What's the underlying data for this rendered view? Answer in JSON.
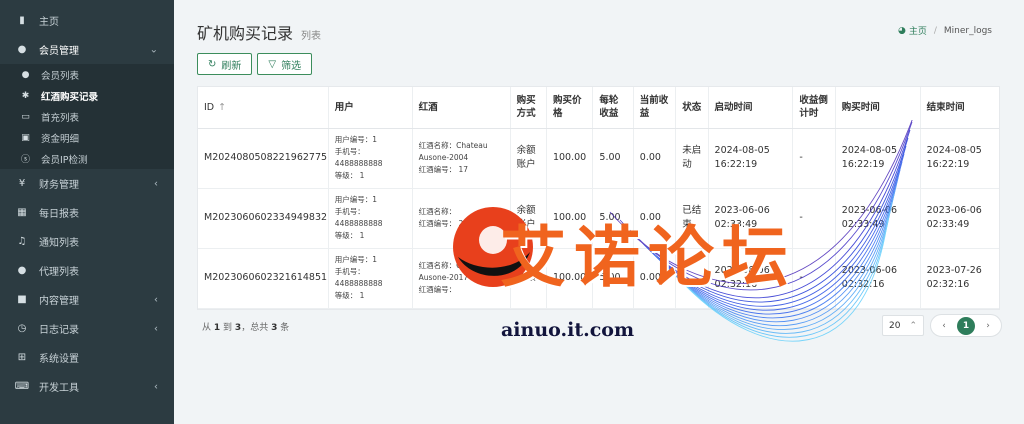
{
  "sidebar": {
    "items": [
      {
        "label": "主页",
        "icon": "bar-chart-icon"
      },
      {
        "label": "会员管理",
        "icon": "user-icon",
        "open": true,
        "children": [
          {
            "label": "会员列表",
            "icon": "user-icon"
          },
          {
            "label": "红酒购买记录",
            "icon": "bug-icon",
            "active": true
          },
          {
            "label": "首充列表",
            "icon": "card-icon"
          },
          {
            "label": "资金明细",
            "icon": "money-icon"
          },
          {
            "label": "会员IP检测",
            "icon": "skype-icon"
          }
        ]
      },
      {
        "label": "财务管理",
        "icon": "cny-icon"
      },
      {
        "label": "每日报表",
        "icon": "calendar-icon"
      },
      {
        "label": "通知列表",
        "icon": "bell-icon"
      },
      {
        "label": "代理列表",
        "icon": "circle-icon"
      },
      {
        "label": "内容管理",
        "icon": "bookmark-icon"
      },
      {
        "label": "日志记录",
        "icon": "clock-icon"
      },
      {
        "label": "系统设置",
        "icon": "windows-icon"
      },
      {
        "label": "开发工具",
        "icon": "keyboard-icon"
      }
    ]
  },
  "header": {
    "title": "矿机购买记录",
    "subtitle": "列表",
    "breadcrumb": {
      "home": "主页",
      "current": "Miner_logs"
    }
  },
  "toolbar": {
    "refresh_label": "刷新",
    "filter_label": "筛选"
  },
  "table": {
    "columns": [
      "ID",
      "用户",
      "红酒",
      "购买方式",
      "购买价格",
      "每轮收益",
      "当前收益",
      "状态",
      "启动时间",
      "收益倒计时",
      "购买时间",
      "结束时间"
    ],
    "rows": [
      {
        "id": "M2024080508221962775",
        "user_no": "用户编号：1",
        "phone_label": "手机号：",
        "phone": "4488888888",
        "level": "等级： 1",
        "wine_name_1": "红酒名称：Chateau",
        "wine_name_2": "Ausone-2004",
        "wine_no": "红酒编号： 17",
        "pay_1": "余额",
        "pay_2": "账户",
        "price": "100.00",
        "round_income": "5.00",
        "current_income": "0.00",
        "status_1": "未启",
        "status_2": "动",
        "start_date": "2024-08-05",
        "start_time": "16:22:19",
        "countdown": "-",
        "buy_date": "2024-08-05",
        "buy_time": "16:22:19",
        "end_date": "2024-08-05",
        "end_time": "16:22:19"
      },
      {
        "id": "M2023060602334949832",
        "user_no": "用户编号：1",
        "phone_label": "手机号：",
        "phone": "4488888888",
        "level": "等级： 1",
        "wine_name_1": "红酒名称：",
        "wine_name_2": "",
        "wine_no": "红酒编号： 20",
        "pay_1": "余额",
        "pay_2": "账户",
        "price": "100.00",
        "round_income": "5.00",
        "current_income": "0.00",
        "status_1": "已结",
        "status_2": "束",
        "start_date": "2023-06-06",
        "start_time": "02:33:49",
        "countdown": "-",
        "buy_date": "2023-06-06",
        "buy_time": "02:33:49",
        "end_date": "2023-06-06",
        "end_time": "02:33:49"
      },
      {
        "id": "M2023060602321614851",
        "user_no": "用户编号：1",
        "phone_label": "手机号：",
        "phone": "4488888888",
        "level": "等级： 1",
        "wine_name_1": "红酒名称：Chateau",
        "wine_name_2": "Ausone-2017",
        "wine_no": "红酒编号：",
        "pay_1": "余额",
        "pay_2": "",
        "price": "100.00",
        "round_income": "5.00",
        "current_income": "0.00",
        "status_1": "",
        "status_2": "",
        "start_date": "2023-06-06",
        "start_time": "02:32:16",
        "countdown": "-",
        "buy_date": "2023-06-06",
        "buy_time": "02:32:16",
        "end_date": "2023-07-26",
        "end_time": "02:32:16"
      }
    ]
  },
  "pagination": {
    "info_prefix": "从",
    "from": "1",
    "to_word": "到",
    "to": "3",
    "total_prefix": "，总共",
    "total": "3",
    "unit": "条",
    "page_size": "20",
    "current_page": "1"
  },
  "watermark": {
    "text": "艾诺论坛",
    "url": "ainuo.it.com"
  },
  "colors": {
    "accent": "#2e7d5b",
    "sidebar_bg": "#2c3b41",
    "watermark_orange": "#f0641e",
    "watermark_navy": "#12143c"
  }
}
